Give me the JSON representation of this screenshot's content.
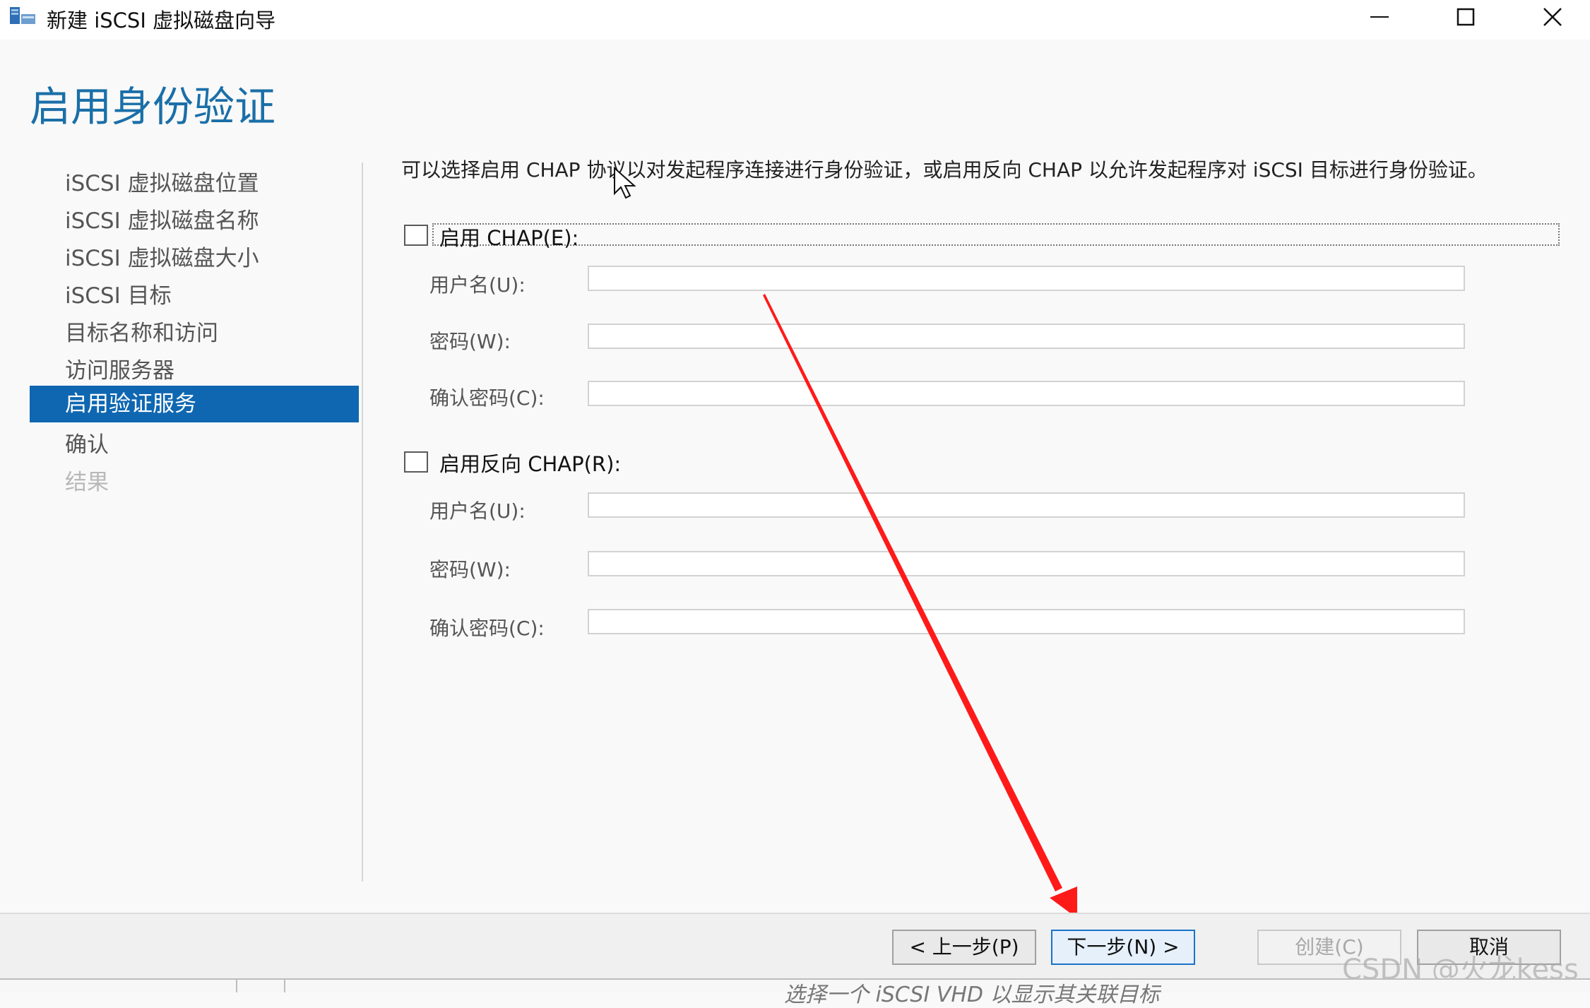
{
  "window": {
    "title": "新建 iSCSI 虚拟磁盘向导",
    "minimize_icon": "minimize-icon",
    "maximize_icon": "maximize-icon",
    "close_icon": "close-icon"
  },
  "page": {
    "heading": "启用身份验证"
  },
  "nav": {
    "items": [
      {
        "label": "iSCSI 虚拟磁盘位置",
        "state": "normal"
      },
      {
        "label": "iSCSI 虚拟磁盘名称",
        "state": "normal"
      },
      {
        "label": "iSCSI 虚拟磁盘大小",
        "state": "normal"
      },
      {
        "label": "iSCSI 目标",
        "state": "normal"
      },
      {
        "label": "目标名称和访问",
        "state": "normal"
      },
      {
        "label": "访问服务器",
        "state": "normal"
      },
      {
        "label": "启用验证服务",
        "state": "active"
      },
      {
        "label": "确认",
        "state": "normal"
      },
      {
        "label": "结果",
        "state": "disabled"
      }
    ]
  },
  "content": {
    "description": "可以选择启用 CHAP 协议以对发起程序连接进行身份验证，或启用反向 CHAP 以允许发起程序对 iSCSI 目标进行身份验证。",
    "chap": {
      "label": "启用 CHAP(E):",
      "checked": false,
      "username_label": "用户名(U):",
      "password_label": "密码(W):",
      "confirm_label": "确认密码(C):",
      "username_value": "",
      "password_value": "",
      "confirm_value": ""
    },
    "reverse_chap": {
      "label": "启用反向 CHAP(R):",
      "checked": false,
      "username_label": "用户名(U):",
      "password_label": "密码(W):",
      "confirm_label": "确认密码(C):",
      "username_value": "",
      "password_value": "",
      "confirm_value": ""
    }
  },
  "annotation": {
    "arrow_color": "#ff1a1a"
  },
  "footer": {
    "prev_label": "< 上一步(P)",
    "next_label": "下一步(N) >",
    "create_label": "创建(C)",
    "cancel_label": "取消"
  },
  "watermark": "CSDN @火龙kess",
  "background_strip": {
    "text": "选择一个 iSCSI VHD 以显示其关联目标"
  }
}
